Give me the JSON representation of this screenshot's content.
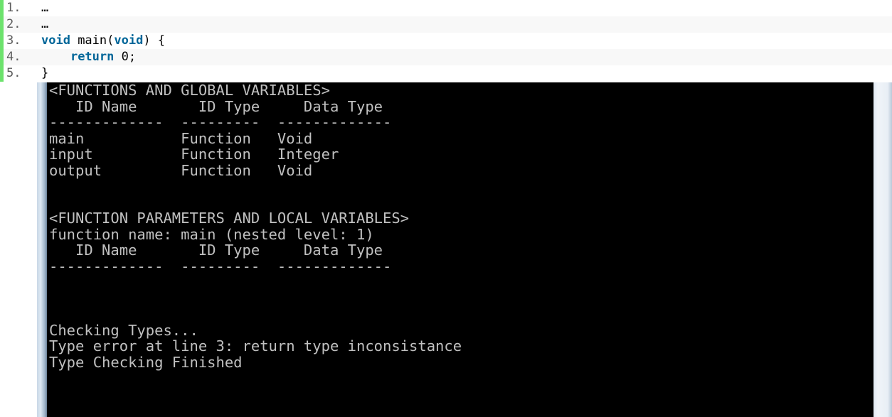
{
  "code_listing": {
    "lines": [
      {
        "number": "1.",
        "text": "…"
      },
      {
        "number": "2.",
        "text": "…"
      },
      {
        "number": "3.",
        "kw1": "void",
        "mid": " main(",
        "kw2": "void",
        "end": ") {"
      },
      {
        "number": "4.",
        "indent": "    ",
        "kw": "return",
        "rest": " 0;"
      },
      {
        "number": "5.",
        "text": "}"
      }
    ]
  },
  "console": {
    "lines": [
      "<FUNCTIONS AND GLOBAL VARIABLES>",
      "   ID Name       ID Type     Data Type",
      "-------------  ---------  -------------",
      "main           Function   Void",
      "input          Function   Integer",
      "output         Function   Void",
      "",
      "",
      "<FUNCTION PARAMETERS AND LOCAL VARIABLES>",
      "function name: main (nested level: 1)",
      "   ID Name       ID Type     Data Type",
      "-------------  ---------  -------------",
      "",
      "",
      "",
      "Checking Types...",
      "Type error at line 3: return type inconsistance",
      "Type Checking Finished"
    ]
  },
  "colors": {
    "gutter_bar": "#6ce26c",
    "keyword": "#006699",
    "line_number": "#5c5c5c",
    "console_bg": "#000000",
    "console_text": "#c0c0c0"
  }
}
